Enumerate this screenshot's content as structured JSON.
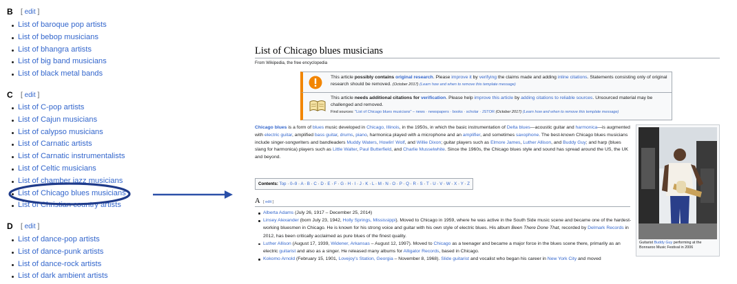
{
  "left": {
    "edit_label": "edit",
    "sections": [
      {
        "letter": "B",
        "items": [
          "List of baroque pop artists",
          "List of bebop musicians",
          "List of bhangra artists",
          "List of big band musicians",
          "List of black metal bands"
        ]
      },
      {
        "letter": "C",
        "items": [
          "List of C-pop artists",
          "List of Cajun musicians",
          "List of calypso musicians",
          "List of Carnatic artists",
          "List of Carnatic instrumentalists",
          "List of Celtic musicians",
          "List of chamber jazz musicians",
          "List of Chicago blues musicians",
          "List of Christian country artists"
        ]
      },
      {
        "letter": "D",
        "items": [
          "List of dance-pop artists",
          "List of dance-punk artists",
          "List of dance-rock artists",
          "List of dark ambient artists"
        ]
      }
    ]
  },
  "annotation": {
    "highlight_color": "#1f3b8a",
    "arrow_color": "#2a4fa8"
  },
  "article": {
    "title": "List of Chicago blues musicians",
    "tagline": "From Wikipedia, the free encyclopedia",
    "notice1": {
      "t1": "This article ",
      "b1": "possibly contains ",
      "l1": "original research",
      "t2": ". Please ",
      "l2": "improve it",
      "t3": " by ",
      "l3": "verifying",
      "t4": " the claims made and adding ",
      "l4": "inline citations",
      "t5": ". Statements consisting only of original research should be removed. ",
      "date": "(October 2017)",
      "learn": "(Learn how and when to remove this template message)"
    },
    "notice2": {
      "t1": "This article ",
      "b1": "needs additional citations for ",
      "l1": "verification",
      "t2": ". Please help ",
      "l2": "improve this article",
      "t3": " by ",
      "l3": "adding citations to reliable sources",
      "t4": ". Unsourced material may be challenged and removed.",
      "find_label": "Find sources: ",
      "find_query": "\"List of Chicago blues musicians\"",
      "find_links": "– news · newspapers · books · scholar · JSTOR",
      "date": "(October 2017)",
      "learn": "(Learn how and when to remove this template message)"
    },
    "intro": {
      "p1": "Chicago blues",
      "p2": " is a form of ",
      "p3": "blues",
      "p4": " music developed in ",
      "p5": "Chicago, Illinois",
      "p6": ", in the 1950s, in which the basic instrumentation of ",
      "p7": "Delta blues",
      "p8": "—acoustic guitar and ",
      "p9": "harmonica",
      "p10": "—is augmented with ",
      "p11": "electric guitar",
      "p12": ", amplified ",
      "p13": "bass guitar",
      "p14": ", ",
      "p15": "drums",
      "p16": ", ",
      "p17": "piano",
      "p18": ", harmonica played with a microphone and an ",
      "p19": "amplifier",
      "p20": ", and sometimes ",
      "p21": "saxophone",
      "p22": ". The best-known Chicago blues musicians include singer-songwriters and bandleaders ",
      "p23": "Muddy Waters",
      "p24": ", ",
      "p25": "Howlin' Wolf",
      "p26": ", and ",
      "p27": "Willie Dixon",
      "p28": "; guitar players such as ",
      "p29": "Elmore James",
      "p30": ", ",
      "p31": "Luther Allison",
      "p32": ", and ",
      "p33": "Buddy Guy",
      "p34": "; and harp (blues slang for harmonica) players such as ",
      "p35": "Little Walter",
      "p36": ", ",
      "p37": "Paul Butterfield",
      "p38": ", and ",
      "p39": "Charlie Musselwhite",
      "p40": ". Since the 1960s, the Chicago blues style and sound has spread around the US, the UK and beyond."
    },
    "thumb": {
      "c1": "Guitarist ",
      "c2": "Buddy Guy",
      "c3": " performing at the Bonnaroo Music Festival in 2006"
    },
    "toc": {
      "label": "Contents:",
      "top": "Top",
      "items": [
        "0–9",
        "A",
        "B",
        "C",
        "D",
        "E",
        "F",
        "G",
        "H",
        "I",
        "J",
        "K",
        "L",
        "M",
        "N",
        "O",
        "P",
        "Q",
        "R",
        "S",
        "T",
        "U",
        "V",
        "W",
        "X",
        "Y",
        "Z"
      ]
    },
    "section_a": {
      "heading": "A",
      "edit": "edit"
    },
    "entries": [
      {
        "name": "Alberta Adams",
        "rest": " (July 26, 1917 – December 25, 2014)"
      },
      {
        "name": "Linsey Alexander",
        "t1": " (born July 23, 1942, ",
        "l1": "Holly Springs, Mississippi",
        "t2": "). Moved to Chicago in 1959, where he was active in the South Side music scene and became one of the hardest-working bluesmen in Chicago. He is known for his strong voice and guitar with his own style of electric blues. His album ",
        "album": "Been There Done That",
        "t3": ", recorded by ",
        "l2": "Delmark Records",
        "t4": " in 2012, has been critically acclaimed as pure blues of the finest quality."
      },
      {
        "name": "Luther Allison",
        "t1": " (August 17, 1939, ",
        "l1": "Widener, Arkansas",
        "t2": " – August 12, 1997). Moved to ",
        "l2": "Chicago",
        "t3": " as a teenager and became a major force in the blues scene there, primarily as an electric ",
        "l3": "guitarist",
        "t4": " and also as a singer. He released many albums for ",
        "l4": "Alligator Records",
        "t5": ", based in Chicago."
      },
      {
        "name": "Kokomo Arnold",
        "t1": " (February 15, 1901, ",
        "l1": "Lovejoy's Station, Georgia",
        "t2": " – November 8, 1968). ",
        "l2": "Slide guitarist",
        "t3": " and vocalist who began his career in ",
        "l3": "New York City",
        "t4": " and moved"
      }
    ]
  }
}
